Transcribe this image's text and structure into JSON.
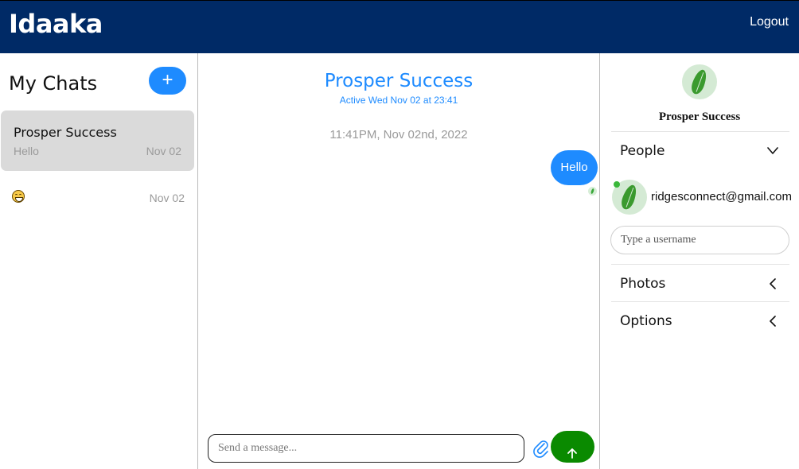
{
  "header": {
    "brand": "Idaaka",
    "logout_label": "Logout"
  },
  "sidebar": {
    "title": "My Chats",
    "new_chat_label": "+",
    "chats": [
      {
        "name": "Prosper Success",
        "preview": "Hello",
        "date": "Nov 02"
      },
      {
        "name": "",
        "icon": "grinning-emoji-icon",
        "preview": "",
        "date": "Nov 02"
      }
    ]
  },
  "conversation": {
    "title": "Prosper Success",
    "status": "Active Wed Nov 02 at 23:41",
    "timestamp": "11:41PM, Nov 02nd, 2022",
    "messages": [
      {
        "text": "Hello",
        "from": "me"
      }
    ],
    "input_placeholder": "Send a message..."
  },
  "details": {
    "name": "Prosper Success",
    "people_label": "People",
    "member_email": "ridgesconnect@gmail.com",
    "username_placeholder": "Type a username",
    "photos_label": "Photos",
    "options_label": "Options"
  },
  "colors": {
    "header": "#002a66",
    "accent": "#1e8bff",
    "send_button": "#0a8a00",
    "online": "#3ab83a"
  }
}
